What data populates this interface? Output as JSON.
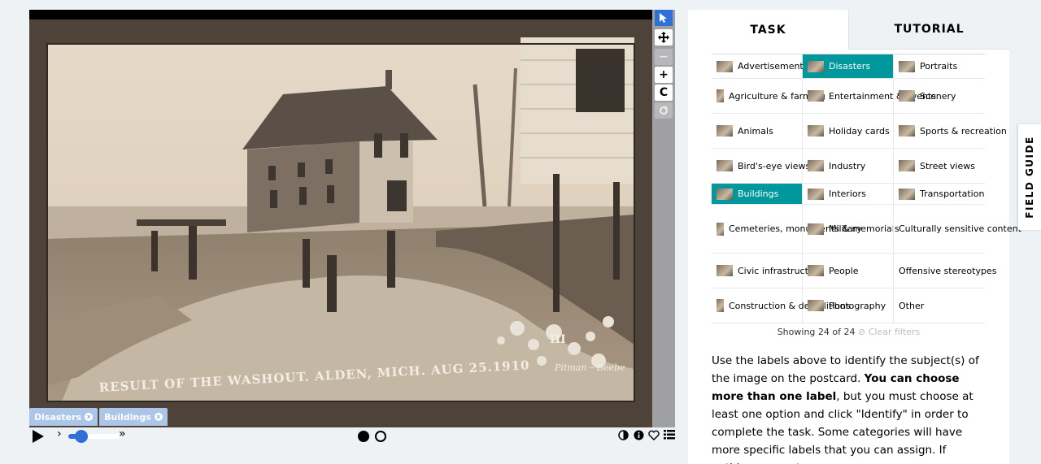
{
  "viewer": {
    "photo_caption_left": "RESULT OF THE WASHOUT. ALDEN, MICH. AUG 25.1910",
    "photo_caption_right": "Pitman – Beebe",
    "photo_mark": "III",
    "toolbar": {
      "pointer_icon": "arrow-pointer-icon",
      "move_icon": "move-arrows-icon",
      "zoom_out_icon": "minus-icon",
      "zoom_in_icon": "plus-icon",
      "rotate_icon": "rotate-icon",
      "reset_icon": "reset-icon",
      "zoom_out_glyph": "−",
      "zoom_in_glyph": "+",
      "rotate_glyph": "C"
    },
    "chips": [
      {
        "label": "Disasters"
      },
      {
        "label": "Buildings"
      }
    ],
    "playback": {
      "speed_level": 0.25,
      "frame_count": 2,
      "current_frame": 1,
      "slow_glyph": "›",
      "fast_glyph": "»"
    }
  },
  "panel": {
    "tabs": [
      {
        "label": "TASK",
        "active": true
      },
      {
        "label": "TUTORIAL",
        "active": false
      }
    ],
    "choices": [
      [
        "Advertisement",
        "Disasters",
        "Portraits"
      ],
      [
        "Agriculture & farming",
        "Entertainment & events",
        "Scenery"
      ],
      [
        "Animals",
        "Holiday cards",
        "Sports & recreation"
      ],
      [
        "Bird's-eye views",
        "Industry",
        "Street views"
      ],
      [
        "Buildings",
        "Interiors",
        "Transportation"
      ],
      [
        "Cemeteries, monuments & memorials",
        "Military",
        "Culturally sensitive content"
      ],
      [
        "Civic infrastructure",
        "People",
        "Offensive stereotypes"
      ],
      [
        "Construction & demolitions",
        "Photography",
        "Other"
      ]
    ],
    "selected": [
      "Disasters",
      "Buildings"
    ],
    "showing": "Showing 24 of 24",
    "clear_filters": "Clear filters",
    "instructions": {
      "part1": "Use the labels above to identify the subject(s) of the image on the postcard. ",
      "bold": "You can choose more than one label",
      "part2": ", but you must choose at least one option and click \"Identify\" in order to complete the task. Some categories will have more specific labels that you can assign. If nothing seems to"
    }
  },
  "field_guide": {
    "label": "FIELD GUIDE"
  },
  "colors": {
    "accent": "#00979d",
    "viewer_blue": "#2f6fd8",
    "chip": "#acc6ea"
  }
}
